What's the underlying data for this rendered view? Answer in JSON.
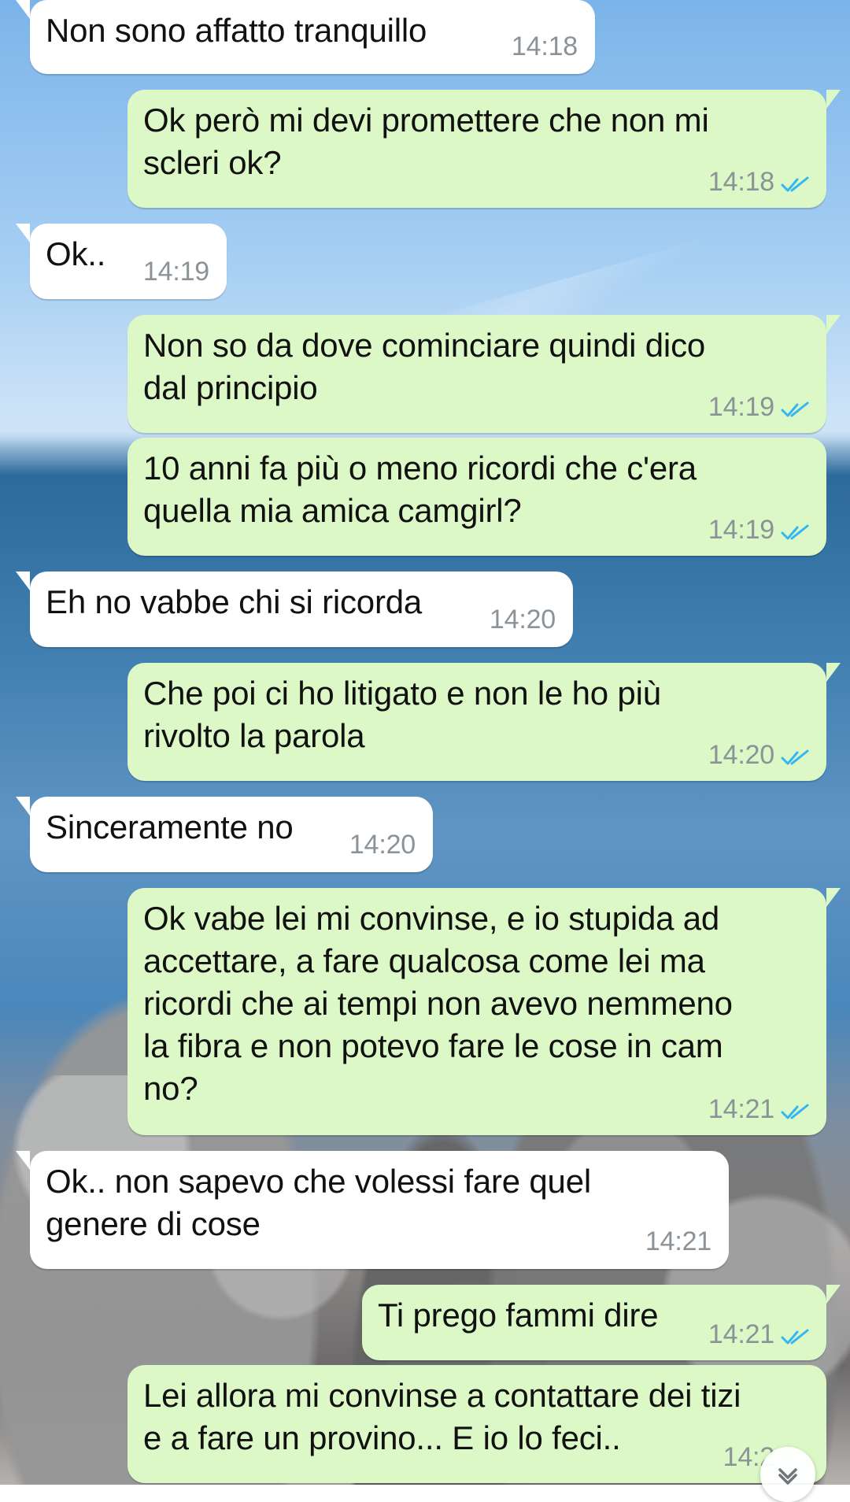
{
  "chat": {
    "messages": [
      {
        "text": "Non sono affatto tranquillo",
        "time": "14:18"
      },
      {
        "text": "Ok però mi devi promettere che non mi\nscleri ok?",
        "time": "14:18"
      },
      {
        "text": "Ok..",
        "time": "14:19"
      },
      {
        "text": "Non so da dove cominciare quindi dico\ndal principio",
        "time": "14:19"
      },
      {
        "text": "10 anni fa più o meno ricordi che c'era\nquella mia amica camgirl?",
        "time": "14:19"
      },
      {
        "text": "Eh no vabbe chi si ricorda",
        "time": "14:20"
      },
      {
        "text": "Che poi ci ho litigato e non le ho più\nrivolto la parola",
        "time": "14:20"
      },
      {
        "text": "Sinceramente no",
        "time": "14:20"
      },
      {
        "text": "Ok vabe lei mi convinse, e io stupida ad\naccettare, a fare qualcosa come lei ma\nricordi che ai tempi non avevo nemmeno\nla fibra e non potevo fare le cose in cam\nno?",
        "time": "14:21"
      },
      {
        "text": "Ok.. non sapevo che volessi fare quel\ngenere di cose",
        "time": "14:21"
      },
      {
        "text": "Ti prego fammi dire",
        "time": "14:21"
      },
      {
        "text": "Lei allora mi convinse a contattare dei tizi\ne a fare un provino... E io lo feci..",
        "time": "14:2"
      }
    ]
  },
  "icons": {
    "read_receipt": "double-check-icon",
    "scroll_down": "chevron-down-icon"
  },
  "colors": {
    "incoming_bubble": "#ffffff",
    "outgoing_bubble": "#dcf8c6",
    "read_tick": "#34b7f1",
    "timestamp": "#8c9398"
  }
}
